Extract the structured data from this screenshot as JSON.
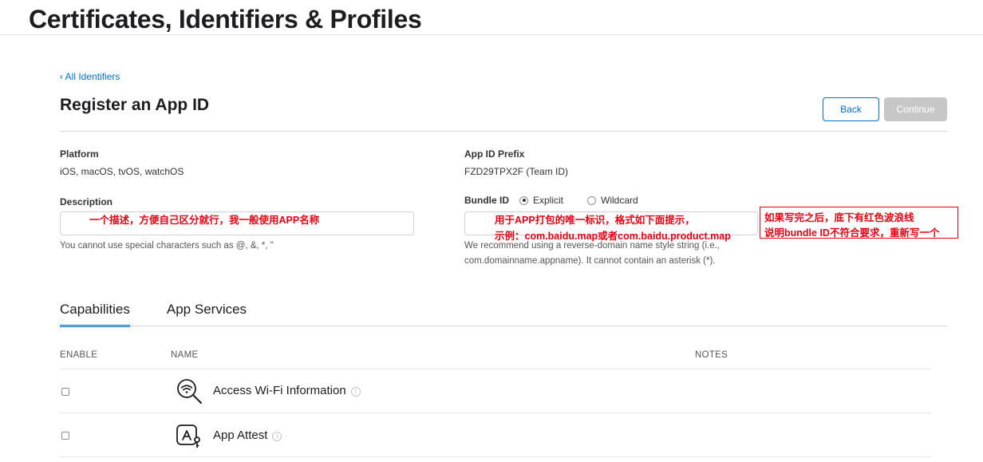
{
  "page": {
    "title": "Certificates, Identifiers & Profiles"
  },
  "nav": {
    "back_link": "‹ All Identifiers"
  },
  "form": {
    "title": "Register an App ID",
    "back_button": "Back",
    "continue_button": "Continue",
    "platform": {
      "label": "Platform",
      "value": "iOS, macOS, tvOS, watchOS"
    },
    "app_id_prefix": {
      "label": "App ID Prefix",
      "value": "FZD29TPX2F (Team ID)"
    },
    "description": {
      "label": "Description",
      "value": "",
      "hint": "You cannot use special characters such as @, &, *, \""
    },
    "bundle_id": {
      "label": "Bundle ID",
      "options": [
        "Explicit",
        "Wildcard"
      ],
      "selected": "Explicit",
      "value": "",
      "hint_line1": "We recommend using a reverse-domain name style string (i.e.,",
      "hint_line2": "com.domainname.appname). It cannot contain an asterisk (*)."
    }
  },
  "annotations": {
    "description_note": "一个描述，方便自己区分就行，我一般使用APP名称",
    "bundle_note_line1": "用于APP打包的唯一标识，格式如下面提示，",
    "bundle_note_line2": "示例：com.baidu.map或者com.baidu.product.map",
    "warning_line1": "如果写完之后，底下有红色波浪线",
    "warning_line2": "说明bundle ID不符合要求，重新写一个",
    "color": "#e60012"
  },
  "tabs": [
    {
      "label": "Capabilities",
      "active": true
    },
    {
      "label": "App Services",
      "active": false
    }
  ],
  "table": {
    "columns": {
      "enable": "ENABLE",
      "name": "NAME",
      "notes": "NOTES"
    },
    "rows": [
      {
        "name": "Access Wi-Fi Information",
        "icon": "wifi-search-icon",
        "enabled": false
      },
      {
        "name": "App Attest",
        "icon": "app-attest-icon",
        "enabled": false
      }
    ]
  },
  "colors": {
    "accent": "#0070c9",
    "disabled_button": "#c7c7c7"
  }
}
